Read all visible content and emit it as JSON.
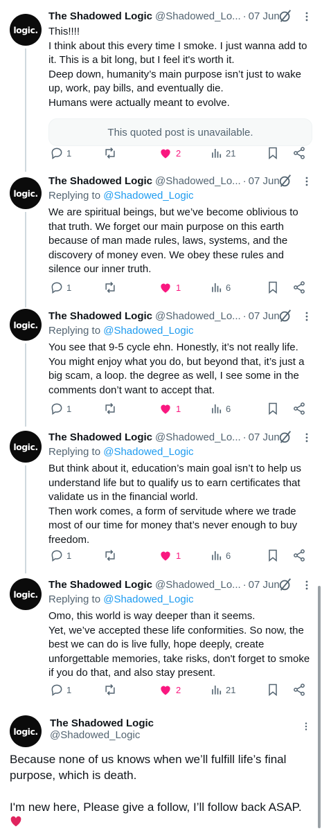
{
  "author": {
    "name": "The Shadowed Logic",
    "handle": "@Shadowed_Lo...",
    "handle_full": "@Shadowed_Logic",
    "avatar_text": "logic."
  },
  "replying_prefix": "Replying to",
  "replying_to": "@Shadowed_Logic",
  "posts": [
    {
      "date": "07 Jun",
      "text": "This!!!!\nI think about this every time I smoke. I just wanna add to it. This is a bit long, but I feel it's worth it.\nDeep down, humanity’s main purpose isn’t just to wake up, work, pay bills, and eventually die.\nHumans were actually meant to evolve.",
      "quoted": "This quoted post is unavailable.",
      "replies": "1",
      "reposts": "",
      "likes": "2",
      "views": "21"
    },
    {
      "date": "07 Jun",
      "text": "We are spiritual beings, but we’ve become oblivious to that truth. We forget our main purpose on this earth because of man made rules, laws, systems, and the discovery of money even. We obey these rules and silence our inner truth.",
      "replies": "1",
      "reposts": "",
      "likes": "1",
      "views": "6"
    },
    {
      "date": "07 Jun",
      "text": "You see that 9-5 cycle ehn. Honestly, it’s not really life. You might enjoy what you do, but beyond that, it’s just a big scam, a loop. the degree as well, I see some in the comments don’t want to accept that.",
      "replies": "1",
      "reposts": "",
      "likes": "1",
      "views": "6"
    },
    {
      "date": "07 Jun",
      "text": "But think about it, education’s main goal isn’t to help us understand life but to qualify us to earn certificates that validate us in the financial world.\nThen work comes, a form of servitude where we trade most of our time for money that’s never enough to buy freedom.",
      "replies": "1",
      "reposts": "",
      "likes": "1",
      "views": "6"
    },
    {
      "date": "07 Jun",
      "text": "Omo, this world is way deeper than it seems.\nYet, we’ve accepted these life conformities. So now, the best we can do is live fully, hope deeply, create unforgettable memories, take risks, don't forget to smoke if you do that, and also stay present.",
      "replies": "1",
      "reposts": "",
      "likes": "2",
      "views": "21"
    }
  ],
  "last_post": {
    "text": "Because none of us knows when we’ll fulfill life’s final purpose, which is death.\n\nI'm new here, Please give a follow, I’ll follow back ASAP."
  },
  "colors": {
    "text": "#0f1419",
    "muted": "#536471",
    "link": "#1d9bf0",
    "like": "#f91880"
  },
  "icons": [
    "reply-icon",
    "repost-icon",
    "heart-icon",
    "views-icon",
    "bookmark-icon",
    "share-icon",
    "grok-icon",
    "more-icon"
  ]
}
